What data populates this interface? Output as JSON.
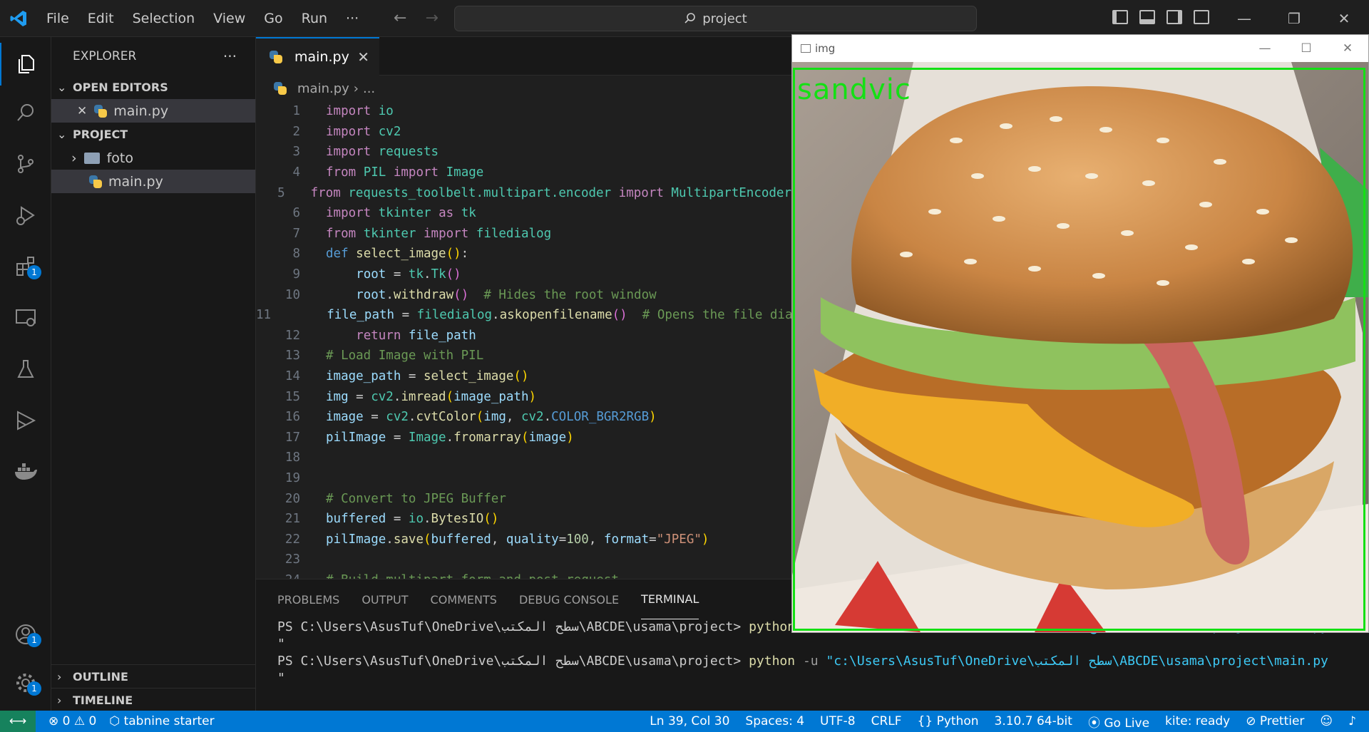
{
  "titlebar": {
    "menu": [
      "File",
      "Edit",
      "Selection",
      "View",
      "Go",
      "Run",
      "···"
    ],
    "search": "project"
  },
  "activity": {
    "badges": {
      "extensions": "1",
      "accounts": "1",
      "settings": "1"
    }
  },
  "sidebar": {
    "title": "EXPLORER",
    "more": "···",
    "open_editors": {
      "label": "OPEN EDITORS",
      "items": [
        {
          "name": "main.py"
        }
      ]
    },
    "project": {
      "label": "PROJECT",
      "items": [
        {
          "name": "foto",
          "type": "folder"
        },
        {
          "name": "main.py",
          "type": "file"
        }
      ]
    },
    "outline": "OUTLINE",
    "timeline": "TIMELINE"
  },
  "editor": {
    "tab": "main.py",
    "breadcrumb": {
      "file": "main.py",
      "rest": "..."
    },
    "lines": [
      {
        "n": "1",
        "html": "<span class='kw'>import</span> <span class='cls'>io</span>"
      },
      {
        "n": "2",
        "html": "<span class='kw'>import</span> <span class='cls'>cv2</span>"
      },
      {
        "n": "3",
        "html": "<span class='kw'>import</span> <span class='cls'>requests</span>"
      },
      {
        "n": "4",
        "html": "<span class='kw'>from</span> <span class='cls'>PIL</span> <span class='kw'>import</span> <span class='cls'>Image</span>"
      },
      {
        "n": "5",
        "html": "<span class='kw'>from</span> <span class='cls'>requests_toolbelt.multipart.encoder</span> <span class='kw'>import</span> <span class='cls'>MultipartEncoder</span>"
      },
      {
        "n": "6",
        "html": "<span class='kw'>import</span> <span class='cls'>tkinter</span> <span class='kw'>as</span> <span class='cls'>tk</span>"
      },
      {
        "n": "7",
        "html": "<span class='kw'>from</span> <span class='cls'>tkinter</span> <span class='kw'>import</span> <span class='cls'>filedialog</span>"
      },
      {
        "n": "8",
        "html": "<span class='bl'>def</span> <span class='fn'>select_image</span><span class='p1'>()</span>:"
      },
      {
        "n": "9",
        "html": "    <span class='var'>root</span> = <span class='cls'>tk</span>.<span class='cls'>Tk</span><span class='p2'>()</span>"
      },
      {
        "n": "10",
        "html": "    <span class='var'>root</span>.<span class='fn'>withdraw</span><span class='p2'>()</span>  <span class='cm'># Hides the root window</span>"
      },
      {
        "n": "11",
        "html": "    <span class='var'>file_path</span> = <span class='cls'>filedialog</span>.<span class='fn'>askopenfilename</span><span class='p2'>()</span>  <span class='cm'># Opens the file dialog</span>"
      },
      {
        "n": "12",
        "html": "    <span class='kw'>return</span> <span class='var'>file_path</span>"
      },
      {
        "n": "13",
        "html": "<span class='cm'># Load Image with PIL</span>"
      },
      {
        "n": "14",
        "html": "<span class='var'>image_path</span> = <span class='fn'>select_image</span><span class='p1'>()</span>"
      },
      {
        "n": "15",
        "html": "<span class='var'>img</span> = <span class='cls'>cv2</span>.<span class='fn'>imread</span><span class='p1'>(</span><span class='var'>image_path</span><span class='p1'>)</span>"
      },
      {
        "n": "16",
        "html": "<span class='var'>image</span> = <span class='cls'>cv2</span>.<span class='fn'>cvtColor</span><span class='p1'>(</span><span class='var'>img</span>, <span class='cls'>cv2</span>.<span class='bl'>COLOR_BGR2RGB</span><span class='p1'>)</span>"
      },
      {
        "n": "17",
        "html": "<span class='var'>pilImage</span> = <span class='cls'>Image</span>.<span class='fn'>fromarray</span><span class='p1'>(</span><span class='var'>image</span><span class='p1'>)</span>"
      },
      {
        "n": "18",
        "html": ""
      },
      {
        "n": "19",
        "html": ""
      },
      {
        "n": "20",
        "html": "<span class='cm'># Convert to JPEG Buffer</span>"
      },
      {
        "n": "21",
        "html": "<span class='var'>buffered</span> = <span class='cls'>io</span>.<span class='fn'>BytesIO</span><span class='p1'>()</span>"
      },
      {
        "n": "22",
        "html": "<span class='var'>pilImage</span>.<span class='fn'>save</span><span class='p1'>(</span><span class='var'>buffered</span>, <span class='var'>quality</span>=<span class='nm'>100</span>, <span class='var'>format</span>=<span class='st'>\"JPEG\"</span><span class='p1'>)</span>"
      },
      {
        "n": "23",
        "html": ""
      },
      {
        "n": "24",
        "html": "<span class='cm'># Build multipart form and post request</span>"
      }
    ]
  },
  "panel": {
    "tabs": [
      "PROBLEMS",
      "OUTPUT",
      "COMMENTS",
      "DEBUG CONSOLE",
      "TERMINAL"
    ],
    "active_tab": "TERMINAL",
    "terminal": [
      {
        "prompt": "PS C:\\Users\\AsusTuf\\OneDrive\\سطح المكتب\\ABCDE\\usama\\project> ",
        "cmd": "python",
        "flag": " -u ",
        "path": "\"c:\\Users\\AsusTuf\\OneDrive\\سطح المكتب\\ABCDE\\usama\\project\\main.py"
      },
      {
        "prompt": "\"",
        "cmd": "",
        "flag": "",
        "path": ""
      },
      {
        "prompt": "PS C:\\Users\\AsusTuf\\OneDrive\\سطح المكتب\\ABCDE\\usama\\project> ",
        "cmd": "python",
        "flag": " -u ",
        "path": "\"c:\\Users\\AsusTuf\\OneDrive\\سطح المكتب\\ABCDE\\usama\\project\\main.py"
      },
      {
        "prompt": "\"",
        "cmd": "",
        "flag": "",
        "path": ""
      }
    ]
  },
  "statusbar": {
    "problems": "⊗ 0 ⚠ 0",
    "tabnine": "tabnine starter",
    "position": "Ln 39, Col 30",
    "spaces": "Spaces: 4",
    "encoding": "UTF-8",
    "eol": "CRLF",
    "language": "Python",
    "interpreter": "3.10.7 64-bit",
    "golive": "Go Live",
    "kite": "kite: ready",
    "prettier": "Prettier"
  },
  "image_window": {
    "title": "img",
    "detection_label": "sandvic"
  },
  "colors": {
    "accent": "#0078d4",
    "detection": "#14e014",
    "remote": "#16825d"
  }
}
